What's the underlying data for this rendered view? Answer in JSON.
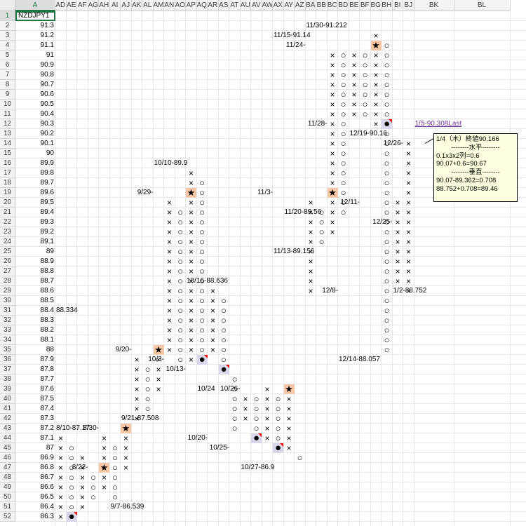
{
  "cell_a1": "NZDJPY1",
  "columns": [
    "A",
    "AD",
    "AE",
    "AF",
    "AG",
    "AH",
    "AI",
    "AJ",
    "AK",
    "AL",
    "AM",
    "AN",
    "AO",
    "AP",
    "AQ",
    "AR",
    "AS",
    "AT",
    "AU",
    "AV",
    "AW",
    "AX",
    "AY",
    "AZ",
    "BA",
    "BB",
    "BC",
    "BD",
    "BE",
    "BF",
    "BG",
    "BH",
    "BI",
    "BJ",
    "BK",
    "BL"
  ],
  "selected_column": "A",
  "rows": [
    "1",
    "2",
    "3",
    "4",
    "5",
    "6",
    "7",
    "8",
    "9",
    "10",
    "11",
    "12",
    "13",
    "14",
    "15",
    "16",
    "17",
    "18",
    "19",
    "20",
    "21",
    "22",
    "23",
    "24",
    "25",
    "26",
    "27",
    "28",
    "29",
    "30",
    "31",
    "32",
    "33",
    "34",
    "35",
    "36",
    "37",
    "38",
    "39",
    "40",
    "41",
    "42",
    "43",
    "44",
    "45",
    "46",
    "47",
    "48",
    "49",
    "50",
    "51",
    "52"
  ],
  "prices": [
    "91.3",
    "91.2",
    "91.1",
    "91",
    "90.9",
    "90.8",
    "90.7",
    "90.6",
    "90.5",
    "90.4",
    "90.3",
    "90.2",
    "90.1",
    "90",
    "89.9",
    "89.8",
    "89.7",
    "89.6",
    "89.5",
    "89.4",
    "89.3",
    "89.2",
    "89.1",
    "89",
    "88.9",
    "88.8",
    "88.7",
    "88.6",
    "88.5",
    "88.4",
    "88.3",
    "88.2",
    "88.1",
    "88",
    "87.9",
    "87.8",
    "87.7",
    "87.6",
    "87.5",
    "87.4",
    "87.3",
    "87.2",
    "87.1",
    "87",
    "86.9",
    "86.8",
    "86.7",
    "86.6",
    "86.5",
    "86.4",
    "86.3"
  ],
  "symbols": {
    "x": "×",
    "o": "○",
    "star": "★",
    "dot": "●"
  },
  "labels": [
    {
      "text": "88.334",
      "row": 31,
      "col": "AD"
    },
    {
      "text": "8/10-87.17",
      "row": 43,
      "col": "AD"
    },
    {
      "text": "8/30-",
      "row": 43,
      "col": "AH",
      "right": true
    },
    {
      "text": "8/22-",
      "row": 47,
      "col": "AG",
      "right": true
    },
    {
      "text": "9/7-86.539",
      "row": 51,
      "col": "AI"
    },
    {
      "text": "9/20-",
      "row": 35,
      "col": "AK",
      "right": true
    },
    {
      "text": "9/21-87.508",
      "row": 42,
      "col": "AJ"
    },
    {
      "text": "9/29-",
      "row": 19,
      "col": "AM",
      "right": true
    },
    {
      "text": "10/10-89.9",
      "row": 16,
      "col": "AM"
    },
    {
      "text": "10/3-",
      "row": 36,
      "col": "AN",
      "right": true
    },
    {
      "text": "10/16-88.636",
      "row": 28,
      "col": "AP"
    },
    {
      "text": "10/13-",
      "row": 37,
      "col": "AP",
      "right": true
    },
    {
      "text": "10/24",
      "row": 39,
      "col": "AQ"
    },
    {
      "text": "10/26-",
      "row": 39,
      "col": "AU",
      "right": true
    },
    {
      "text": "10/20-",
      "row": 44,
      "col": "AR",
      "right": true
    },
    {
      "text": "10/25-",
      "row": 45,
      "col": "AT",
      "right": true
    },
    {
      "text": "10/27-86.9",
      "row": 47,
      "col": "AU"
    },
    {
      "text": "11/3-",
      "row": 19,
      "col": "AX",
      "right": true
    },
    {
      "text": "11/13-89.156",
      "row": 25,
      "col": "AX"
    },
    {
      "text": "11/20-89.56",
      "row": 21,
      "col": "AY"
    },
    {
      "text": "11/15-91.14",
      "row": 3,
      "col": "AX"
    },
    {
      "text": "11/24-",
      "row": 4,
      "col": "BA",
      "right": true
    },
    {
      "text": "11/30-91.212",
      "row": 2,
      "col": "BA"
    },
    {
      "text": "11/28-",
      "row": 12,
      "col": "BC",
      "right": true
    },
    {
      "text": "12/8-",
      "row": 29,
      "col": "BD",
      "right": true
    },
    {
      "text": "12/11-",
      "row": 20,
      "col": "BF",
      "right": true
    },
    {
      "text": "12/14-88.057",
      "row": 36,
      "col": "BD"
    },
    {
      "text": "12/19-90.16",
      "row": 13,
      "col": "BE"
    },
    {
      "text": "12/26-",
      "row": 14,
      "col": "BJ",
      "right": true
    },
    {
      "text": "12/25-",
      "row": 22,
      "col": "BI",
      "right": true
    },
    {
      "text": "1/2-88.752",
      "row": 29,
      "col": "BI"
    },
    {
      "text": "1/5-90.308Last",
      "row": 12,
      "col": "BK",
      "link": true
    }
  ],
  "marks": [
    {
      "col": "AD",
      "from": 44,
      "to": 52,
      "type": "x"
    },
    {
      "col": "AE",
      "from": 45,
      "to": 52,
      "type": "o",
      "special": {
        "52": "dot"
      }
    },
    {
      "col": "AF",
      "from": 46,
      "to": 51,
      "type": "x"
    },
    {
      "col": "AG",
      "from": 48,
      "to": 50,
      "type": "o"
    },
    {
      "col": "AH",
      "from": 44,
      "to": 49,
      "type": "x",
      "special": {
        "47": "star"
      }
    },
    {
      "col": "AI",
      "from": 45,
      "to": 50,
      "type": "o"
    },
    {
      "col": "AJ",
      "from": 43,
      "to": 47,
      "type": "x",
      "special": {
        "43": "star"
      }
    },
    {
      "col": "AK",
      "from": 36,
      "to": 42,
      "type": "x"
    },
    {
      "col": "AL",
      "from": 37,
      "to": 41,
      "type": "o"
    },
    {
      "col": "AM",
      "from": 35,
      "to": 39,
      "type": "x",
      "special": {
        "35": "star"
      }
    },
    {
      "col": "AN",
      "from": 20,
      "to": 35,
      "type": "x"
    },
    {
      "col": "AO",
      "from": 21,
      "to": 36,
      "type": "o"
    },
    {
      "col": "AP",
      "from": 17,
      "to": 36,
      "type": "x",
      "special": {
        "19": "star"
      }
    },
    {
      "col": "AQ",
      "from": 18,
      "to": 36,
      "type": "o",
      "special": {
        "36": "dot"
      }
    },
    {
      "col": "AR",
      "from": 29,
      "to": 35,
      "type": "x"
    },
    {
      "col": "AS",
      "from": 30,
      "to": 37,
      "type": "o",
      "special": {
        "37": "dot"
      }
    },
    {
      "col": "AT",
      "from": 38,
      "to": 43,
      "type": "o"
    },
    {
      "col": "AU",
      "from": 40,
      "to": 42,
      "type": "x"
    },
    {
      "col": "AV",
      "from": 40,
      "to": 44,
      "type": "o",
      "special": {
        "44": "dot"
      }
    },
    {
      "col": "AW",
      "from": 39,
      "to": 44,
      "type": "x"
    },
    {
      "col": "AX",
      "from": 40,
      "to": 45,
      "type": "o",
      "special": {
        "45": "dot"
      }
    },
    {
      "col": "AY",
      "from": 39,
      "to": 45,
      "type": "x",
      "special": {
        "39": "star"
      }
    },
    {
      "col": "AZ",
      "from": 46,
      "to": 46,
      "type": "o"
    },
    {
      "col": "BA",
      "from": 20,
      "to": 29,
      "type": "x"
    },
    {
      "col": "BB",
      "from": 21,
      "to": 24,
      "type": "o"
    },
    {
      "col": "BC",
      "from": 5,
      "to": 23,
      "type": "x",
      "special": {
        "19": "star"
      }
    },
    {
      "col": "BD",
      "from": 5,
      "to": 21,
      "type": "o"
    },
    {
      "col": "BE",
      "from": 5,
      "to": 11,
      "type": "x"
    },
    {
      "col": "BF",
      "from": 5,
      "to": 11,
      "type": "o"
    },
    {
      "col": "BG",
      "from": 3,
      "to": 12,
      "type": "x",
      "special": {
        "4": "star"
      }
    },
    {
      "col": "BH",
      "from": 4,
      "to": 35,
      "type": "o",
      "special": {
        "12": "dot"
      }
    },
    {
      "col": "BI",
      "from": 20,
      "to": 28,
      "type": "x"
    },
    {
      "col": "BJ",
      "from": 14,
      "to": 29,
      "type": "x"
    }
  ],
  "note": {
    "lines": [
      "1/4（木）終値90.166",
      "--------水平--------",
      "0.1x3x2列=0.6",
      "90.07+0.6=90.67",
      "--------垂直--------",
      "90.07-89.362=0.708",
      "88.752+0.708=89.46"
    ],
    "centered": [
      1,
      4
    ]
  }
}
